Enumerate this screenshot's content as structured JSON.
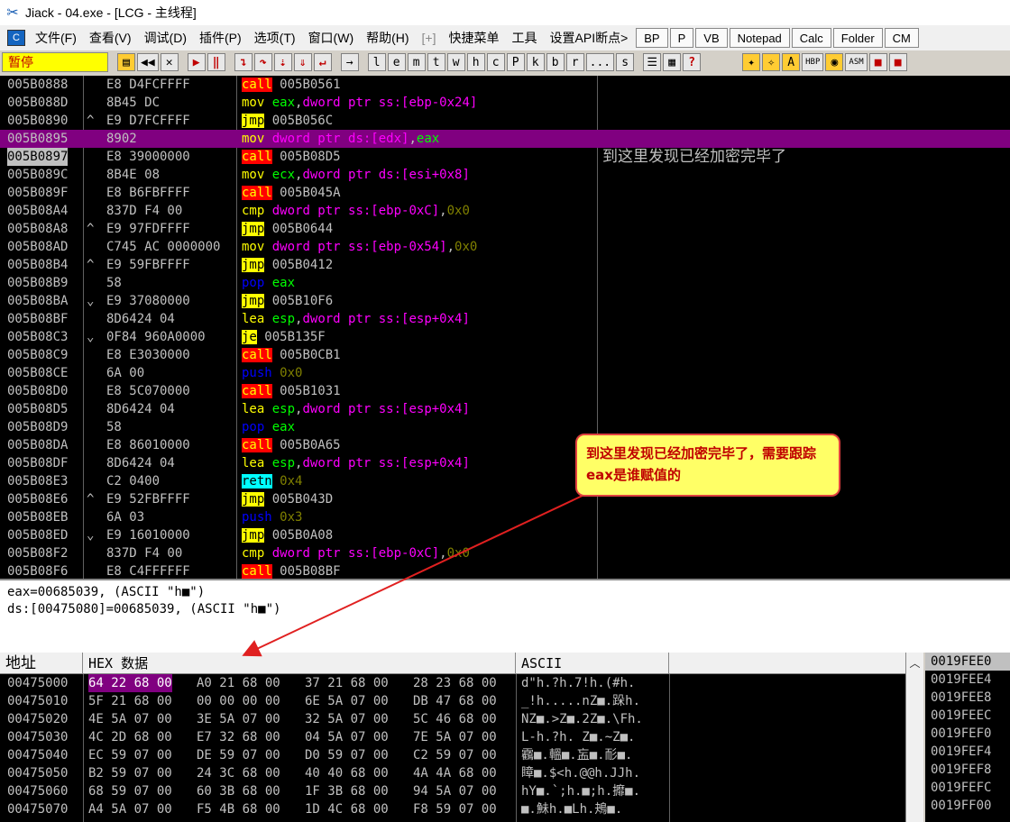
{
  "window": {
    "title": "Jiack    - 04.exe - [LCG -  主线程]"
  },
  "menu": [
    "文件(F)",
    "查看(V)",
    "调试(D)",
    "插件(P)",
    "选项(T)",
    "窗口(W)",
    "帮助(H)",
    "[+]",
    "快捷菜单",
    "工具",
    "设置API断点>"
  ],
  "plugin_buttons": [
    "BP",
    "P",
    "VB",
    "Notepad",
    "Calc",
    "Folder",
    "CM"
  ],
  "status": "暂停",
  "toolbar_letters": [
    "l",
    "e",
    "m",
    "t",
    "w",
    "h",
    "c",
    "P",
    "k",
    "b",
    "r",
    "...",
    "s"
  ],
  "disasm": [
    {
      "addr": "005B0888",
      "mark": "",
      "hex": "E8 D4FCFFFF",
      "mn": "call",
      "ops": [
        [
          "",
          "005B0561"
        ]
      ]
    },
    {
      "addr": "005B088D",
      "mark": "",
      "hex": "8B45 DC",
      "mn": "mov",
      "ops": [
        [
          "reg",
          "eax"
        ],
        [
          "",
          ","
        ],
        [
          "mem",
          "dword ptr ss:[ebp-0x24]"
        ]
      ]
    },
    {
      "addr": "005B0890",
      "mark": "^",
      "hex": "E9 D7FCFFFF",
      "mn": "jmp",
      "ops": [
        [
          "",
          "005B056C"
        ]
      ]
    },
    {
      "addr": "005B0895",
      "mark": "",
      "hex": "8902",
      "mn": "mov",
      "ops": [
        [
          "mem",
          "dword ptr ds:[edx]"
        ],
        [
          "",
          ","
        ],
        [
          "reg",
          "eax"
        ]
      ],
      "hl": true
    },
    {
      "addr": "005B0897",
      "mark": "",
      "hex": "E8 39000000",
      "mn": "call",
      "ops": [
        [
          "",
          "005B08D5"
        ]
      ],
      "sel": true,
      "comment": "到这里发现已经加密完毕了"
    },
    {
      "addr": "005B089C",
      "mark": "",
      "hex": "8B4E 08",
      "mn": "mov",
      "ops": [
        [
          "reg",
          "ecx"
        ],
        [
          "",
          ","
        ],
        [
          "mem",
          "dword ptr ds:[esi+0x8]"
        ]
      ]
    },
    {
      "addr": "005B089F",
      "mark": "",
      "hex": "E8 B6FBFFFF",
      "mn": "call",
      "ops": [
        [
          "",
          "005B045A"
        ]
      ]
    },
    {
      "addr": "005B08A4",
      "mark": "",
      "hex": "837D F4 00",
      "mn": "cmp",
      "ops": [
        [
          "mem",
          "dword ptr ss:[ebp-0xC]"
        ],
        [
          "",
          ","
        ],
        [
          "imm",
          "0x0"
        ]
      ]
    },
    {
      "addr": "005B08A8",
      "mark": "^",
      "hex": "E9 97FDFFFF",
      "mn": "jmp",
      "ops": [
        [
          "",
          "005B0644"
        ]
      ]
    },
    {
      "addr": "005B08AD",
      "mark": "",
      "hex": "C745 AC 0000000",
      "mn": "mov",
      "ops": [
        [
          "mem",
          "dword ptr ss:[ebp-0x54]"
        ],
        [
          "",
          ","
        ],
        [
          "imm",
          "0x0"
        ]
      ]
    },
    {
      "addr": "005B08B4",
      "mark": "^",
      "hex": "E9 59FBFFFF",
      "mn": "jmp",
      "ops": [
        [
          "",
          "005B0412"
        ]
      ]
    },
    {
      "addr": "005B08B9",
      "mark": "",
      "hex": "58",
      "mn": "pop",
      "ops": [
        [
          "reg",
          "eax"
        ]
      ]
    },
    {
      "addr": "005B08BA",
      "mark": "⌄",
      "hex": "E9 37080000",
      "mn": "jmp",
      "ops": [
        [
          "",
          "005B10F6"
        ]
      ]
    },
    {
      "addr": "005B08BF",
      "mark": "",
      "hex": "8D6424 04",
      "mn": "lea",
      "ops": [
        [
          "reg",
          "esp"
        ],
        [
          "",
          ","
        ],
        [
          "mem",
          "dword ptr ss:[esp+0x4]"
        ]
      ]
    },
    {
      "addr": "005B08C3",
      "mark": "⌄",
      "hex": "0F84 960A0000",
      "mn": "je",
      "ops": [
        [
          "",
          "005B135F"
        ]
      ]
    },
    {
      "addr": "005B08C9",
      "mark": "",
      "hex": "E8 E3030000",
      "mn": "call",
      "ops": [
        [
          "",
          "005B0CB1"
        ]
      ]
    },
    {
      "addr": "005B08CE",
      "mark": "",
      "hex": "6A 00",
      "mn": "push",
      "ops": [
        [
          "imm",
          "0x0"
        ]
      ]
    },
    {
      "addr": "005B08D0",
      "mark": "",
      "hex": "E8 5C070000",
      "mn": "call",
      "ops": [
        [
          "",
          "005B1031"
        ]
      ]
    },
    {
      "addr": "005B08D5",
      "mark": "",
      "hex": "8D6424 04",
      "mn": "lea",
      "ops": [
        [
          "reg",
          "esp"
        ],
        [
          "",
          ","
        ],
        [
          "mem",
          "dword ptr ss:[esp+0x4]"
        ]
      ]
    },
    {
      "addr": "005B08D9",
      "mark": "",
      "hex": "58",
      "mn": "pop",
      "ops": [
        [
          "reg",
          "eax"
        ]
      ]
    },
    {
      "addr": "005B08DA",
      "mark": "",
      "hex": "E8 86010000",
      "mn": "call",
      "ops": [
        [
          "",
          "005B0A65"
        ]
      ]
    },
    {
      "addr": "005B08DF",
      "mark": "",
      "hex": "8D6424 04",
      "mn": "lea",
      "ops": [
        [
          "reg",
          "esp"
        ],
        [
          "",
          ","
        ],
        [
          "mem",
          "dword ptr ss:[esp+0x4]"
        ]
      ]
    },
    {
      "addr": "005B08E3",
      "mark": "",
      "hex": "C2 0400",
      "mn": "retn",
      "ops": [
        [
          "imm",
          "0x4"
        ]
      ]
    },
    {
      "addr": "005B08E6",
      "mark": "^",
      "hex": "E9 52FBFFFF",
      "mn": "jmp",
      "ops": [
        [
          "",
          "005B043D"
        ]
      ]
    },
    {
      "addr": "005B08EB",
      "mark": "",
      "hex": "6A 03",
      "mn": "push",
      "ops": [
        [
          "imm",
          "0x3"
        ]
      ]
    },
    {
      "addr": "005B08ED",
      "mark": "⌄",
      "hex": "E9 16010000",
      "mn": "jmp",
      "ops": [
        [
          "",
          "005B0A08"
        ]
      ]
    },
    {
      "addr": "005B08F2",
      "mark": "",
      "hex": "837D F4 00",
      "mn": "cmp",
      "ops": [
        [
          "mem",
          "dword ptr ss:[ebp-0xC]"
        ],
        [
          "",
          ","
        ],
        [
          "imm",
          "0x0"
        ]
      ]
    },
    {
      "addr": "005B08F6",
      "mark": "",
      "hex": "E8 C4FFFFFF",
      "mn": "call",
      "ops": [
        [
          "",
          "005B08BF"
        ]
      ]
    }
  ],
  "info": {
    "line1": "eax=00685039, (ASCII \"h■\")",
    "line2": "ds:[00475080]=00685039, (ASCII \"h■\")"
  },
  "dump_header": {
    "addr": "地址",
    "hex": "HEX 数据",
    "ascii": "ASCII"
  },
  "dump": [
    {
      "addr": "00475000",
      "hex": [
        "64 22 68 00",
        "A0 21 68 00",
        "37 21 68 00",
        "28 23 68 00"
      ],
      "ascii": "d\"h.?h.7!h.(#h."
    },
    {
      "addr": "00475010",
      "hex": [
        "5F 21 68 00",
        "00 00 00 00",
        "6E 5A 07 00",
        "DB 47 68 00"
      ],
      "ascii": "_!h.....nZ■.跺h."
    },
    {
      "addr": "00475020",
      "hex": [
        "4E 5A 07 00",
        "3E 5A 07 00",
        "32 5A 07 00",
        "5C 46 68 00"
      ],
      "ascii": "NZ■.>Z■.2Z■.\\Fh."
    },
    {
      "addr": "00475030",
      "hex": [
        "4C 2D 68 00",
        "E7 32 68 00",
        "04 5A 07 00",
        "7E 5A 07 00"
      ],
      "ascii": "L-h.?h. Z■.~Z■."
    },
    {
      "addr": "00475040",
      "hex": [
        "EC 59 07 00",
        "DE 59 07 00",
        "D0 59 07 00",
        "C2 59 07 00"
      ],
      "ascii": "靏■.轀■.衁■.耏■."
    },
    {
      "addr": "00475050",
      "hex": [
        "B2 59 07 00",
        "24 3C 68 00",
        "40 40 68 00",
        "4A 4A 68 00"
      ],
      "ascii": "瞕■.$<h.@@h.JJh."
    },
    {
      "addr": "00475060",
      "hex": [
        "68 59 07 00",
        "60 3B 68 00",
        "1F 3B 68 00",
        "94 5A 07 00"
      ],
      "ascii": "hY■.`;h.■;h.攠■."
    },
    {
      "addr": "00475070",
      "hex": [
        "A4 5A 07 00",
        "F5 4B 68 00",
        "1D 4C 68 00",
        "F8 59 07 00"
      ],
      "ascii": " ■.鮇h.■Lh.鴂■."
    }
  ],
  "stack": [
    "0019FEE0",
    "0019FEE4",
    "0019FEE8",
    "0019FEEC",
    "0019FEF0",
    "0019FEF4",
    "0019FEF8",
    "0019FEFC",
    "0019FF00"
  ],
  "callout": "到这里发现已经加密完毕了，需要跟踪eax是谁赋值的",
  "colors": {
    "highlight_row": "#800080",
    "call": "#ff0000",
    "jmp": "#ffff00",
    "retn": "#00ffff",
    "register": "#00ff00",
    "memory": "#ff00ff"
  }
}
